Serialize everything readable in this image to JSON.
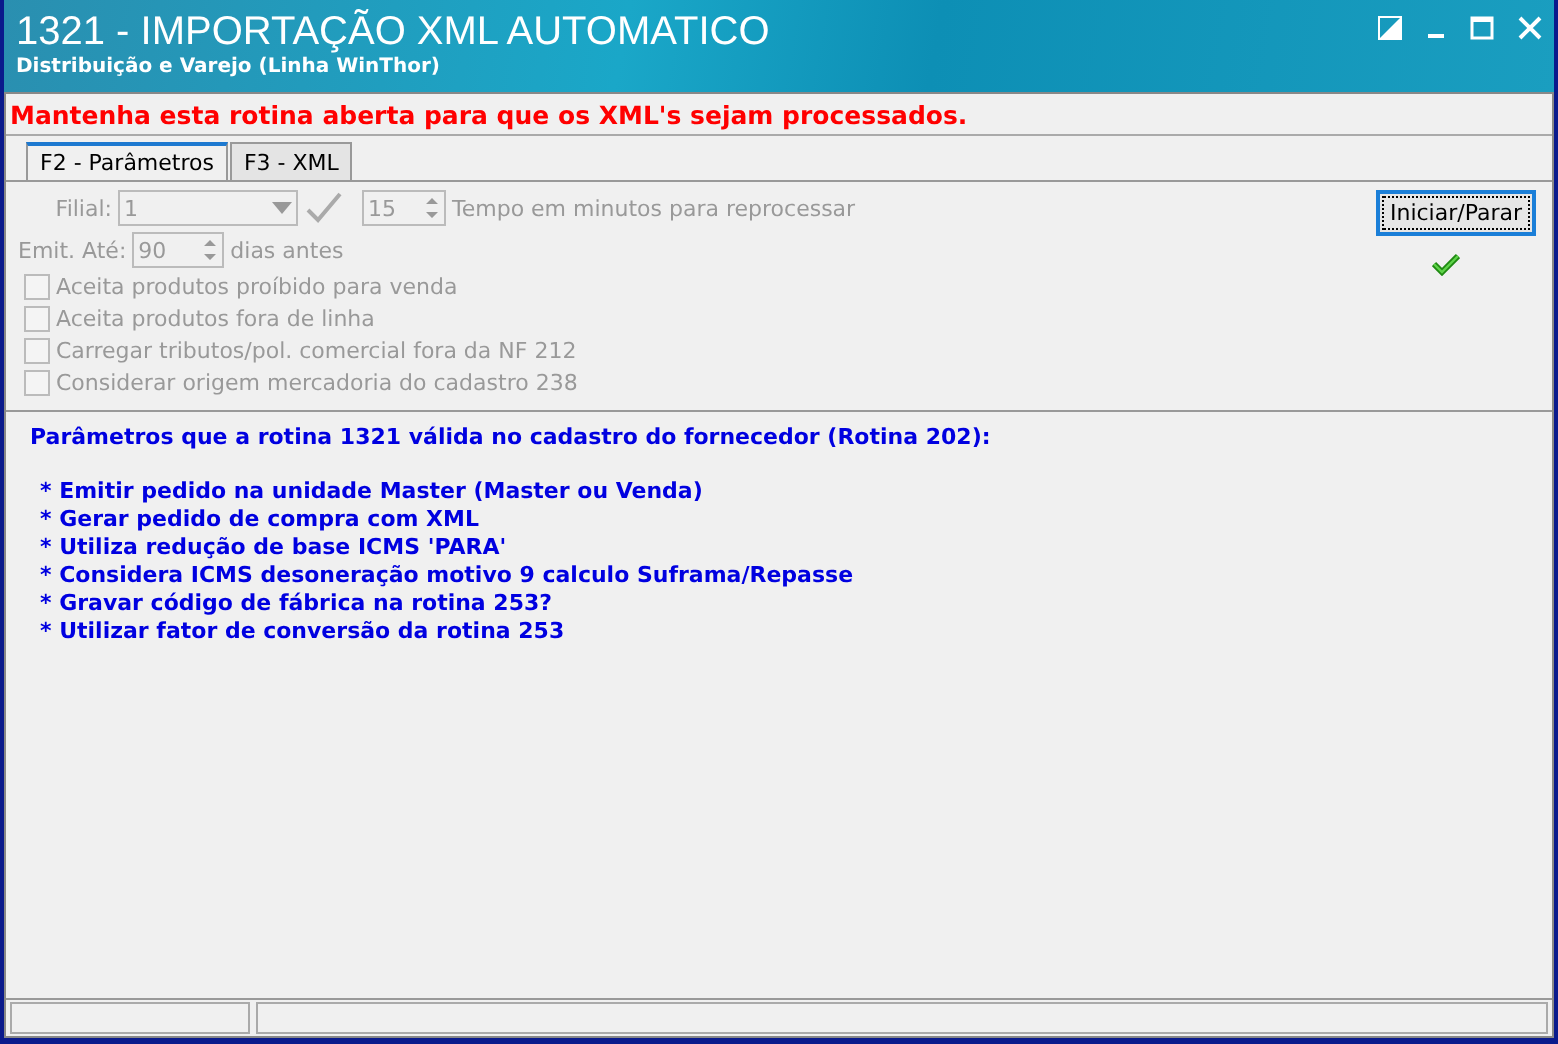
{
  "window": {
    "title": "1321 - IMPORTAÇÃO XML AUTOMATICO",
    "subtitle": "Distribuição e Varejo (Linha WinThor)"
  },
  "notice": "Mantenha esta rotina aberta para que os XML's sejam processados.",
  "tabs": [
    {
      "label": "F2 - Parâmetros",
      "selected": true
    },
    {
      "label": "F3 - XML",
      "selected": false
    }
  ],
  "form": {
    "disabled": true,
    "filial": {
      "label": "Filial:",
      "value": "1"
    },
    "interval": {
      "value": "15",
      "label": "Tempo em minutos para reprocessar"
    },
    "emit": {
      "label": "Emit. Até:",
      "value": "90",
      "suffix": "dias antes"
    },
    "checkboxes": [
      {
        "label": "Aceita produtos proíbido para venda",
        "checked": false
      },
      {
        "label": "Aceita produtos fora de linha",
        "checked": false
      },
      {
        "label": "Carregar tributos/pol. comercial fora da NF 212",
        "checked": false
      },
      {
        "label": "Considerar origem mercadoria do cadastro 238",
        "checked": false
      }
    ]
  },
  "start_button": {
    "label": "Iniciar/Parar",
    "running": true
  },
  "info": {
    "heading": "Parâmetros que a rotina 1321 válida no cadastro do fornecedor (Rotina 202):",
    "items": [
      "* Emitir pedido na unidade Master (Master ou Venda)",
      "* Gerar pedido de compra com XML",
      "* Utiliza redução de base ICMS 'PARA'",
      "* Considera ICMS desoneração motivo 9 calculo Suframa/Repasse",
      "* Gravar código de fábrica na rotina 253?",
      "* Utilizar fator de conversão da rotina 253"
    ]
  }
}
